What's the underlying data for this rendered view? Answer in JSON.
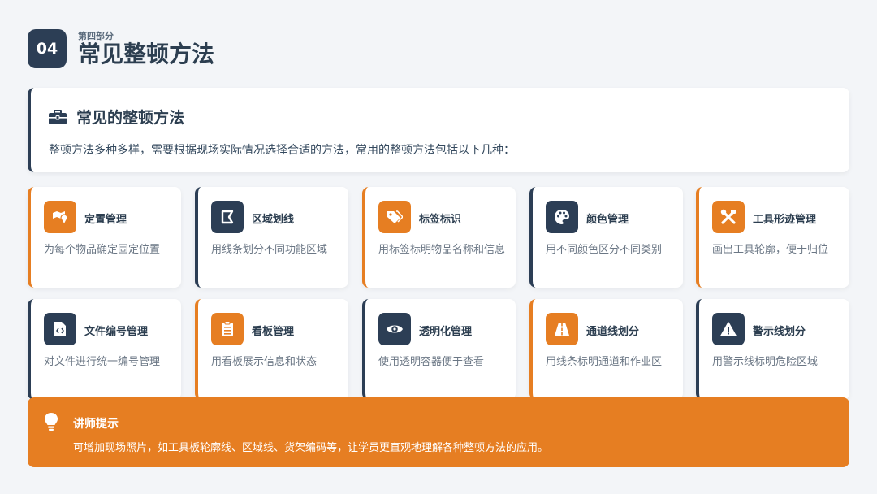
{
  "header": {
    "number": "04",
    "subtitle": "第四部分",
    "title": "常见整顿方法"
  },
  "intro": {
    "icon": "toolbox-icon",
    "title": "常见的整顿方法",
    "text": "整顿方法多种多样，需要根据现场实际情况选择合适的方法，常用的整顿方法包括以下几种："
  },
  "methods": [
    {
      "name": "定置管理",
      "desc": "为每个物品确定固定位置",
      "icon": "map-marker-icon",
      "accent": "#e67e22"
    },
    {
      "name": "区域划线",
      "desc": "用线条划分不同功能区域",
      "icon": "vector-square-icon",
      "accent": "#2c3e55"
    },
    {
      "name": "标签标识",
      "desc": "用标签标明物品名称和信息",
      "icon": "tags-icon",
      "accent": "#e67e22"
    },
    {
      "name": "颜色管理",
      "desc": "用不同颜色区分不同类别",
      "icon": "palette-icon",
      "accent": "#2c3e55"
    },
    {
      "name": "工具形迹管理",
      "desc": "画出工具轮廓，便于归位",
      "icon": "tools-icon",
      "accent": "#e67e22"
    },
    {
      "name": "文件编号管理",
      "desc": "对文件进行统一编号管理",
      "icon": "file-code-icon",
      "accent": "#2c3e55"
    },
    {
      "name": "看板管理",
      "desc": "用看板展示信息和状态",
      "icon": "clipboard-list-icon",
      "accent": "#e67e22"
    },
    {
      "name": "透明化管理",
      "desc": "使用透明容器便于查看",
      "icon": "eye-icon",
      "accent": "#2c3e55"
    },
    {
      "name": "通道线划分",
      "desc": "用线条标明通道和作业区",
      "icon": "road-icon",
      "accent": "#e67e22"
    },
    {
      "name": "警示线划分",
      "desc": "用警示线标明危险区域",
      "icon": "warning-triangle-icon",
      "accent": "#2c3e55"
    }
  ],
  "tip": {
    "icon": "lightbulb-icon",
    "title": "讲师提示",
    "text": "可增加现场照片，如工具板轮廓线、区域线、货架编码等，让学员更直观地理解各种整顿方法的应用。"
  }
}
